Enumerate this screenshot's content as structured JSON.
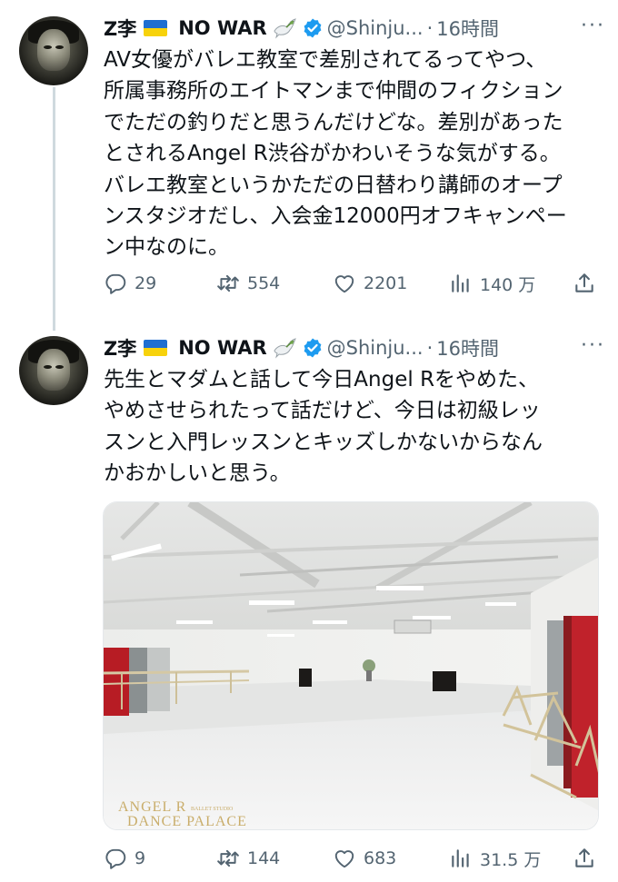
{
  "tweets": [
    {
      "author_name": "Z李",
      "tail_label": "NO WAR",
      "handle": "@Shinju...",
      "separator": "·",
      "time": "16時間",
      "more": "···",
      "text_lines": [
        "AV女優がバレエ教室で差別されてるってやつ、",
        "所属事務所のエイトマンまで仲間のフィクション",
        "でただの釣りだと思うんだけどな。差別があった",
        "とされるAngel R渋谷がかわいそうな気がする。",
        "バレエ教室というかただの日替わり講師のオープ",
        "ンスタジオだし、入会金12000円オフキャンペー",
        "ン中なのに。"
      ],
      "replies": "29",
      "retweets": "554",
      "likes": "2201",
      "views": "140 万"
    },
    {
      "author_name": "Z李",
      "tail_label": "NO WAR",
      "handle": "@Shinju...",
      "separator": "·",
      "time": "16時間",
      "more": "···",
      "text_lines": [
        "先生とマダムと話して今日Angel Rをやめた、",
        "やめさせられたって話だけど、今日は初級レッ",
        "スンと入門レッスンとキッズしかないからなん",
        "かおかしいと思う。"
      ],
      "media": {
        "watermark_line1": "ANGEL R",
        "watermark_small": "BALLET STUDIO",
        "watermark_line2": "DANCE PALACE"
      },
      "replies": "9",
      "retweets": "144",
      "likes": "683",
      "views": "31.5 万"
    }
  ],
  "icons": [
    "reply-icon",
    "retweet-icon",
    "like-icon",
    "views-icon",
    "share-icon",
    "verified-icon",
    "dove-icon",
    "ukraine-flag-icon",
    "more-icon"
  ],
  "colors": {
    "text": "#0f1419",
    "secondary": "#536471",
    "verified": "#1d9bf0",
    "thread_line": "#cfd9de"
  }
}
